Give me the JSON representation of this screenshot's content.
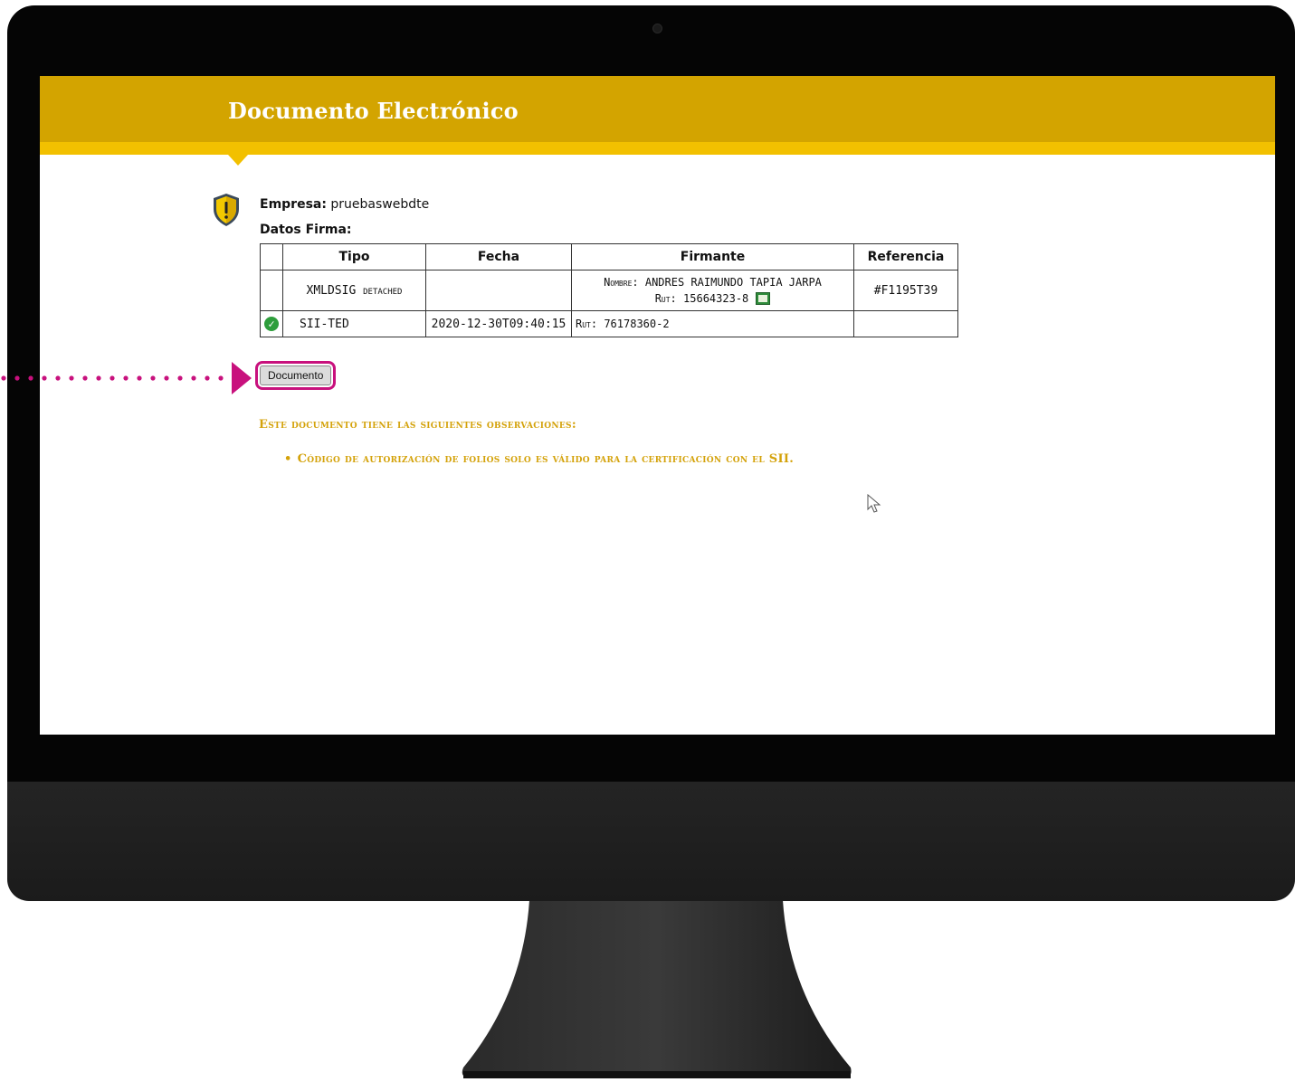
{
  "header": {
    "title": "Documento Electrónico"
  },
  "info": {
    "empresa_label": "Empresa:",
    "empresa_value": "pruebaswebdte",
    "datos_firma_label": "Datos Firma:"
  },
  "signature_table": {
    "columns": [
      "Tipo",
      "Fecha",
      "Firmante",
      "Referencia"
    ],
    "rows": [
      {
        "status_icon": "none",
        "tipo_main": "XMLDSIG",
        "tipo_suffix": "detached",
        "fecha": "",
        "firmante_nombre_label": "Nombre:",
        "firmante_nombre": "ANDRES RAIMUNDO TAPIA JARPA",
        "firmante_rut_label": "Rut:",
        "firmante_rut": "15664323-8",
        "firmante_icon": "certificate-icon",
        "referencia": "#F1195T39"
      },
      {
        "status_icon": "check-icon",
        "tipo_main": "SII-TED",
        "fecha": "2020-12-30T09:40:15",
        "firmante_rut_label": "Rut:",
        "firmante_rut": "76178360-2",
        "referencia": ""
      }
    ]
  },
  "actions": {
    "document_button_label": "Documento"
  },
  "observations": {
    "title": "Este documento tiene las siguientes observaciones:",
    "items": [
      "Código de autorización de folios solo es válido para la certificación con el SII."
    ]
  },
  "colors": {
    "header": "#d3a400",
    "header_stripe": "#f2c000",
    "observation_text": "#d4a20a",
    "annotation": "#c8117d",
    "bezel": "#050505"
  },
  "icons": {
    "shield": "warning-shield-icon",
    "check": "check-icon",
    "certificate": "certificate-icon",
    "cursor": "mouse-cursor-icon",
    "arrow": "dotted-arrow-icon"
  }
}
